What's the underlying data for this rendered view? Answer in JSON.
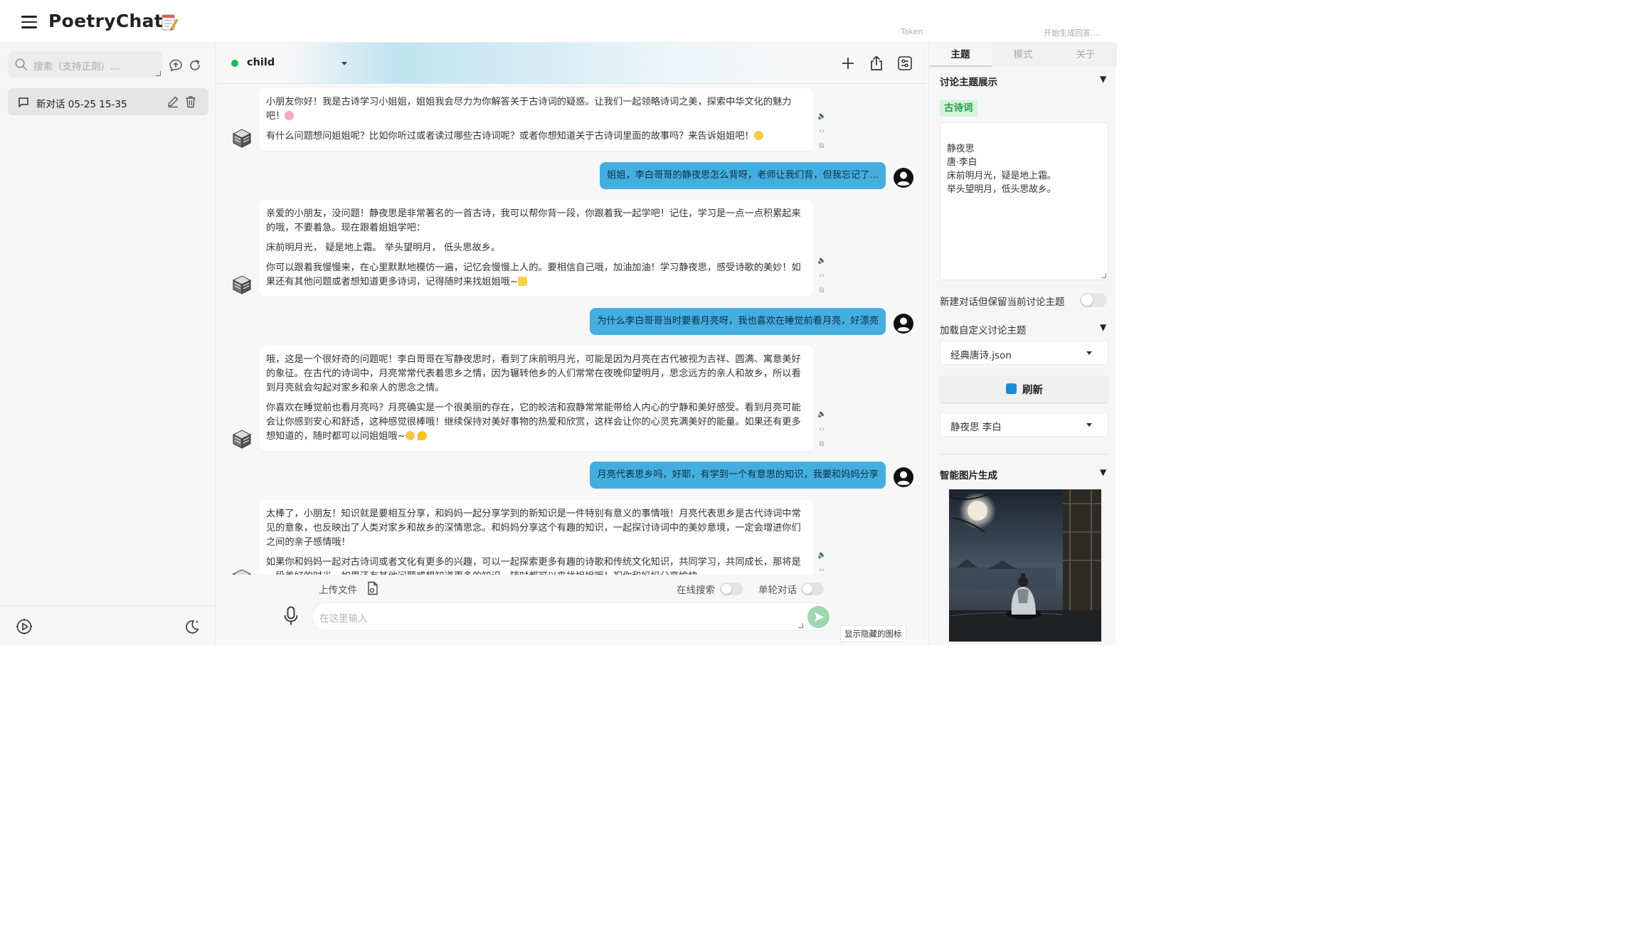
{
  "header": {
    "app_title": "PoetryChat",
    "token_label": "Token",
    "gen_status": "开始生成回答....",
    "menu_icon": "hamburger-icon",
    "title_icon": "memo-icon"
  },
  "sidebar": {
    "search_placeholder": "搜索（支持正则）...",
    "conversations": [
      {
        "label": "新对话 05-25 15-35"
      }
    ]
  },
  "chat": {
    "model_name": "child",
    "status_color": "#21b35b",
    "messages": [
      {
        "role": "assistant",
        "paragraphs": [
          "小朋友你好！我是古诗学习小姐姐，姐姐我会尽力为你解答关于古诗词的疑惑。让我们一起领略诗词之美，探索中华文化的魅力吧！",
          "有什么问题想问姐姐呢？比如你听过或者读过哪些古诗词呢？或者你想知道关于古诗词里面的故事吗？来告诉姐姐吧！"
        ]
      },
      {
        "role": "user",
        "text": "姐姐，李白哥哥的静夜思怎么背呀，老师让我们背，但我忘记了..."
      },
      {
        "role": "assistant",
        "paragraphs": [
          "亲爱的小朋友，没问题！静夜思是非常著名的一首古诗，我可以帮你背一段，你跟着我一起学吧！记住，学习是一点一点积累起来的哦，不要着急。现在跟着姐姐学吧：",
          "床前明月光，  疑是地上霜。  举头望明月，  低头思故乡。",
          "你可以跟着我慢慢来，在心里默默地模仿一遍，记忆会慢慢上人的。要相信自己哦，加油加油！学习静夜思，感受诗歌的美妙！如果还有其他问题或者想知道更多诗词，记得随时来找姐姐哦~"
        ]
      },
      {
        "role": "user",
        "text": "为什么李白哥哥当时要看月亮呀，我也喜欢在睡觉前看月亮，好漂亮"
      },
      {
        "role": "assistant",
        "paragraphs": [
          "哦，这是一个很好奇的问题呢！李白哥哥在写静夜思时，看到了床前明月光，可能是因为月亮在古代被视为吉祥、圆满、寓意美好的象征。在古代的诗词中，月亮常常代表着思乡之情，因为辗转他乡的人们常常在夜晚仰望明月，思念远方的亲人和故乡，所以看到月亮就会勾起对家乡和亲人的思念之情。",
          "你喜欢在睡觉前也看月亮吗？月亮确实是一个很美丽的存在，它的皎洁和寂静常常能带给人内心的宁静和美好感受。看到月亮可能会让你感到安心和舒适，这种感觉很棒哦！继续保持对美好事物的热爱和欣赏，这样会让你的心灵充满美好的能量。如果还有更多想知道的，随时都可以问姐姐哦~"
        ]
      },
      {
        "role": "user",
        "text": "月亮代表思乡吗，好耶，有学到一个有意思的知识，我要和妈妈分享"
      },
      {
        "role": "assistant",
        "paragraphs": [
          "太棒了，小朋友！知识就是要相互分享，和妈妈一起分享学到的新知识是一件特别有意义的事情哦！月亮代表思乡是古代诗词中常见的意象，也反映出了人类对家乡和故乡的深情思念。和妈妈分享这个有趣的知识，一起探讨诗词中的美妙意境，一定会增进你们之间的亲子感情哦！",
          "如果你和妈妈一起对古诗词或者文化有更多的兴趣，可以一起探索更多有趣的诗歌和传统文化知识，共同学习，共同成长，那将是一段美好的时光。如果还有其他问题或想知道更多的知识，随时都可以来找姐姐哦！祝你和妈妈分享愉快~"
        ]
      }
    ]
  },
  "composer": {
    "upload_label": "上传文件",
    "online_search_label": "在线搜索",
    "single_turn_label": "单轮对话",
    "input_placeholder": "在这里输入",
    "hidden_icons_label": "显示隐藏的图标"
  },
  "right_panel": {
    "tabs": [
      "主题",
      "模式",
      "关于"
    ],
    "active_tab": "主题",
    "topic_section_title": "讨论主题展示",
    "topic_tag": "古诗词",
    "topic_text": "静夜思\n唐·李白\n床前明月光，疑是地上霜。\n举头望明月，低头思故乡。",
    "keep_topic_label": "新建对话但保留当前讨论主题",
    "custom_topic_title": "加载自定义讨论主题",
    "custom_topic_file": "经典唐诗.json",
    "refresh_label": "刷新",
    "poem_select": "静夜思 李白",
    "image_gen_title": "智能图片生成"
  }
}
